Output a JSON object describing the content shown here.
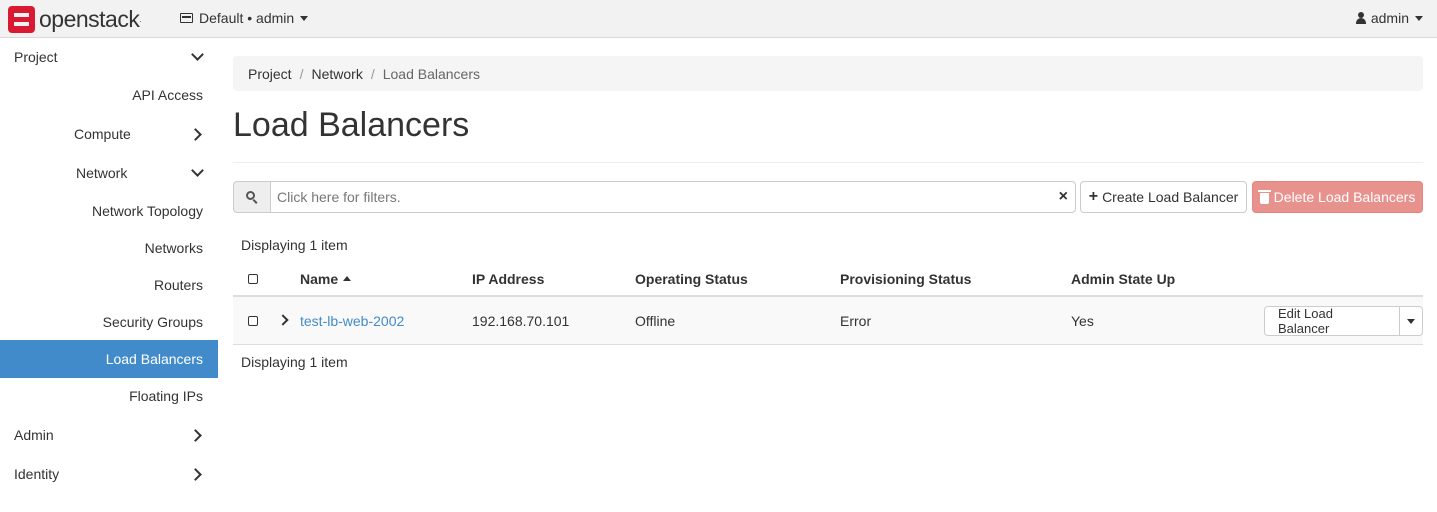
{
  "topbar": {
    "brand": "openstack",
    "brand_mark": ".",
    "project_switcher": "Default • admin",
    "user": "admin"
  },
  "sidebar": {
    "items": [
      {
        "label": "Project",
        "chevron": "down"
      },
      {
        "label": "API Access"
      },
      {
        "label": "Compute",
        "chevron": "right"
      },
      {
        "label": "Network",
        "chevron": "down"
      },
      {
        "label": "Network Topology"
      },
      {
        "label": "Networks"
      },
      {
        "label": "Routers"
      },
      {
        "label": "Security Groups"
      },
      {
        "label": "Load Balancers",
        "active": true
      },
      {
        "label": "Floating IPs"
      },
      {
        "label": "Admin",
        "chevron": "right"
      },
      {
        "label": "Identity",
        "chevron": "right"
      }
    ]
  },
  "breadcrumb": {
    "items": [
      "Project",
      "Network",
      "Load Balancers"
    ]
  },
  "page": {
    "title": "Load Balancers"
  },
  "filter": {
    "placeholder": "Click here for filters.",
    "value": "",
    "clear_icon": "×"
  },
  "actions": {
    "create": "Create Load Balancer",
    "delete": "Delete Load Balancers"
  },
  "table": {
    "count_top": "Displaying 1 item",
    "count_bottom": "Displaying 1 item",
    "columns": [
      "Name",
      "IP Address",
      "Operating Status",
      "Provisioning Status",
      "Admin State Up"
    ],
    "sorted_column": "Name",
    "rows": [
      {
        "name": "test-lb-web-2002",
        "ip": "192.168.70.101",
        "operating_status": "Offline",
        "provisioning_status": "Error",
        "admin_state_up": "Yes",
        "action": "Edit Load Balancer"
      }
    ]
  },
  "colors": {
    "accent": "#428bca",
    "danger_disabled": "#e8928e",
    "brand": "#da1a32"
  }
}
